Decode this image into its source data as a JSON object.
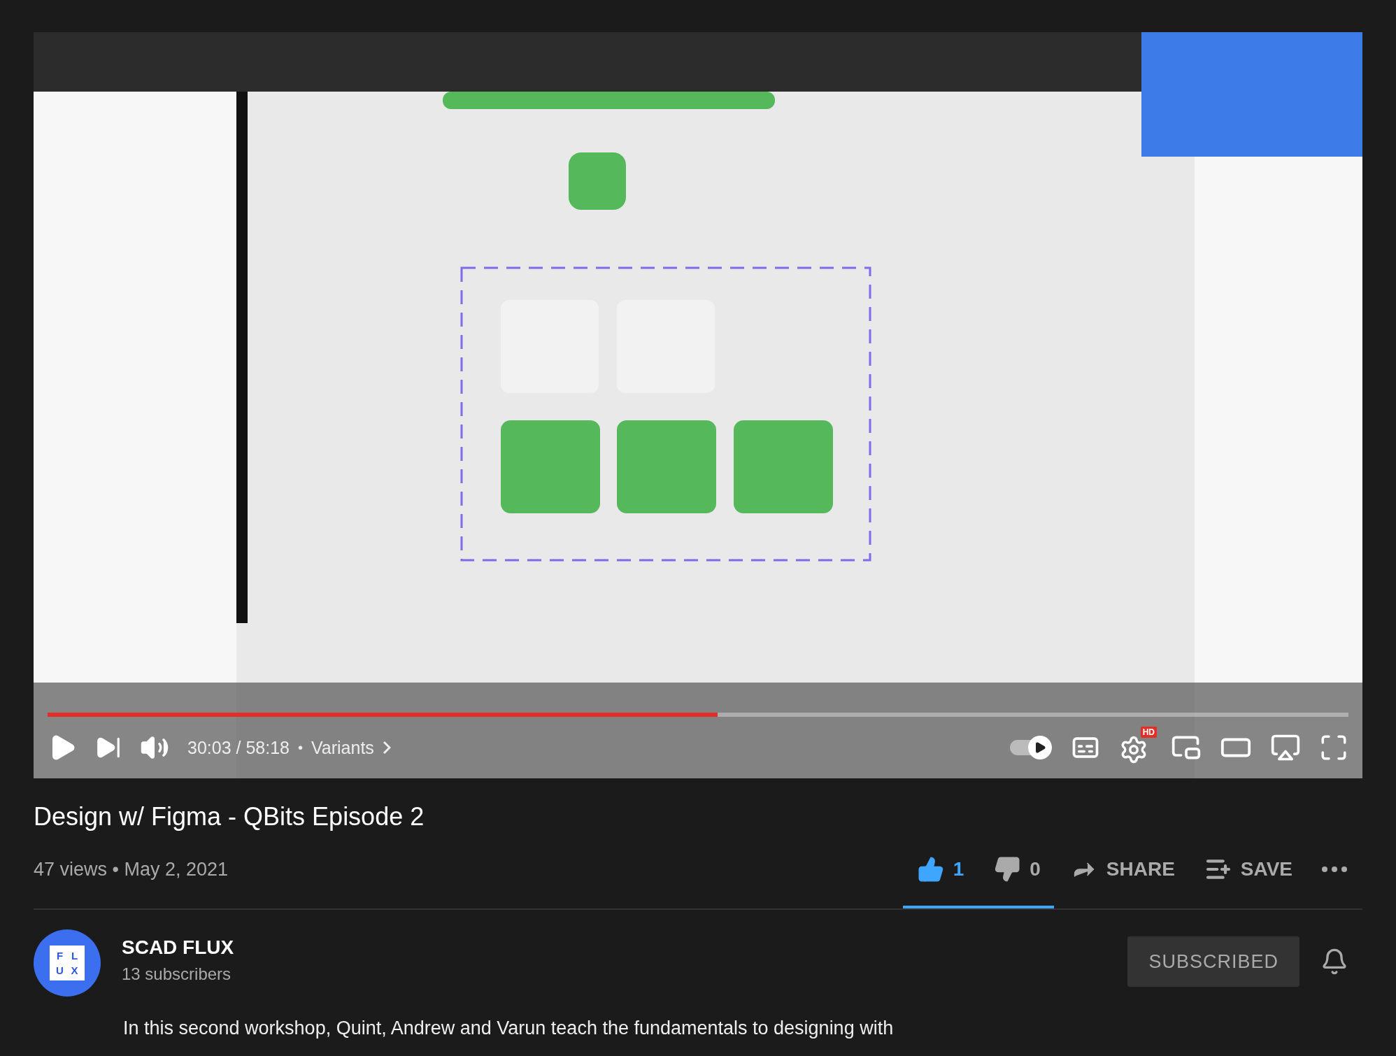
{
  "video": {
    "progress": {
      "level": 0.515
    },
    "time": "30:03 / 58:18",
    "separator": "•",
    "chapter": "Variants",
    "autoplay_on": true,
    "settings_badge": "HD"
  },
  "title": "Design w/ Figma - QBits Episode 2",
  "meta": "47 views • May 2, 2021",
  "actions": [
    {
      "kind": "like",
      "label": "1",
      "selected": true
    },
    {
      "kind": "dislike",
      "label": "0",
      "selected": false
    },
    {
      "kind": "share",
      "label": "SHARE"
    },
    {
      "kind": "save",
      "label": "SAVE"
    },
    {
      "kind": "more"
    }
  ],
  "sentiment": {
    "level": 1
  },
  "channel": {
    "avatar_letters": [
      "F",
      "L",
      "U",
      "X"
    ],
    "name": "SCAD FLUX",
    "subscribers": "13 subscribers",
    "subscribe_button": "SUBSCRIBED",
    "subscribed": true
  },
  "description": "In this second workshop, Quint, Andrew and Varun teach the fundamentals to designing with"
}
